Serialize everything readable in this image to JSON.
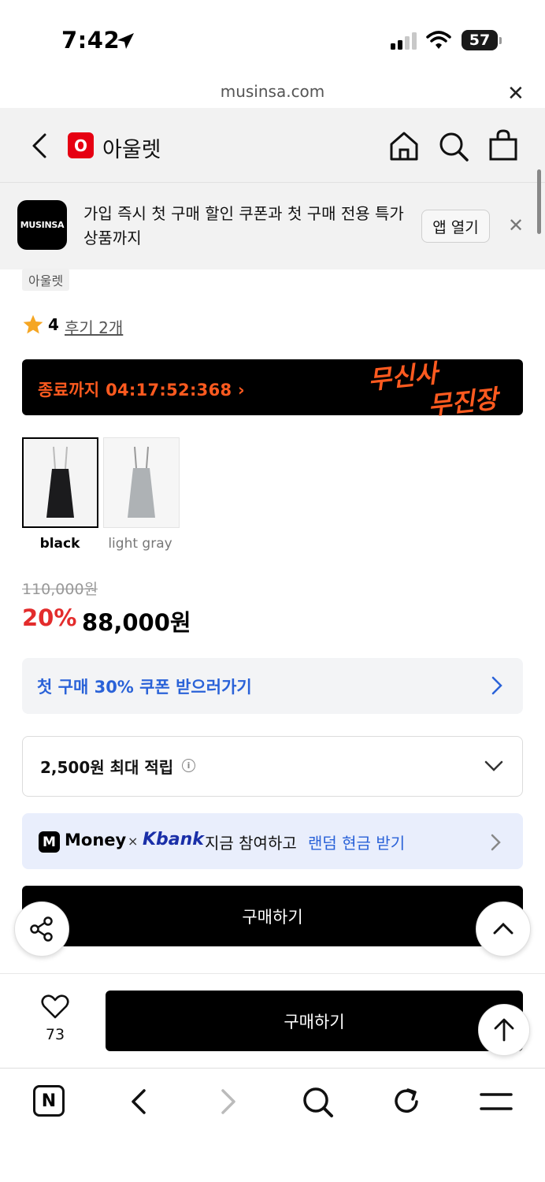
{
  "status_bar": {
    "time": "7:42",
    "battery": "57"
  },
  "browser": {
    "url": "musinsa.com"
  },
  "header": {
    "brand_badge": "O",
    "brand_name": "아울렛"
  },
  "promo": {
    "logo_text": "MUSINSA",
    "text": "가입 즉시 첫 구매 할인 쿠폰과 첫 구매 전용 특가 상품까지",
    "open_app_label": "앱 열기"
  },
  "product": {
    "brand_tag": "아울렛",
    "rating": "4",
    "review_link": "후기 2개",
    "countdown_text": "종료까지 04:17:52:368 ›",
    "countdown_logo_line1": "무신사",
    "countdown_logo_line2": "무진장",
    "colors": [
      {
        "label": "black",
        "selected": true,
        "swatch": "#1b1b1d"
      },
      {
        "label": "light gray",
        "selected": false,
        "swatch": "#aeb2b5"
      }
    ],
    "original_price": "110,000원",
    "discount": "20%",
    "price": "88,000원"
  },
  "coupon": {
    "text": "첫 구매 30% 쿠폰 받으러가기"
  },
  "points": {
    "text": "2,500원 최대 적립"
  },
  "money_banner": {
    "badge": "M",
    "money": "Money",
    "times": "×",
    "kbank": "Kbank",
    "text": "지금 참여하고",
    "link": "랜덤 현금 받기"
  },
  "buy_label": "구매하기",
  "bottom_bar": {
    "like_count": "73",
    "buy_label": "구매하기"
  },
  "toolbar": {
    "n_label": "N"
  },
  "colors": {
    "accent_red": "#e32c2c",
    "link_blue": "#2a62d8",
    "timer_orange": "#ff5a1f",
    "brand_red": "#e60012"
  }
}
